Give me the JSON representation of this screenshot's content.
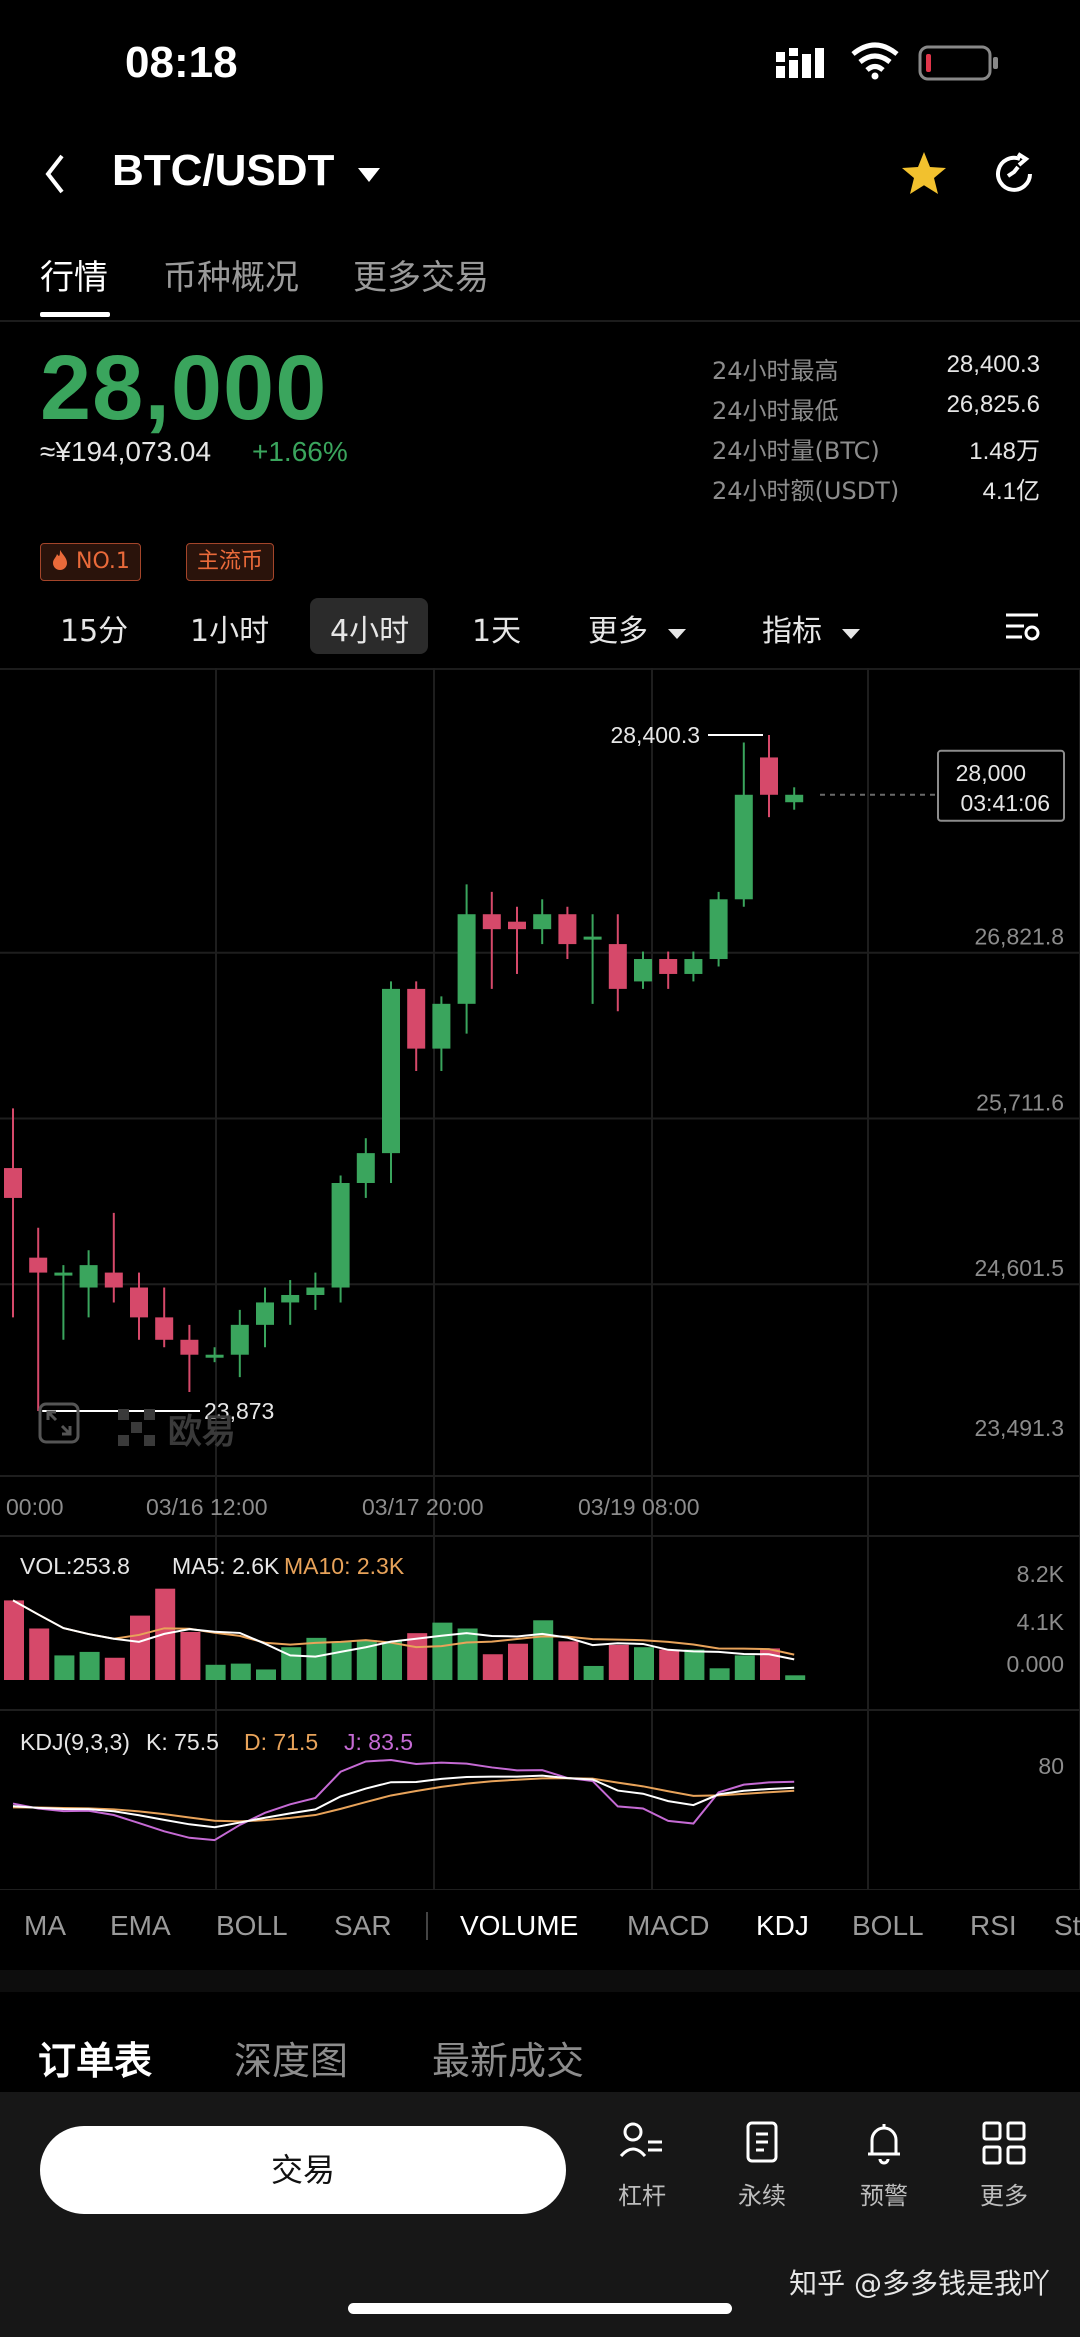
{
  "status_bar": {
    "time": "08:18"
  },
  "header": {
    "pair": "BTC/USDT"
  },
  "tabs": [
    "行情",
    "币种概况",
    "更多交易"
  ],
  "ticker": {
    "price": "28,000",
    "cny": "≈¥194,073.04",
    "change": "+1.66%",
    "stats": [
      {
        "label": "24小时最高",
        "value": "28,400.3"
      },
      {
        "label": "24小时最低",
        "value": "26,825.6"
      },
      {
        "label": "24小时量(BTC)",
        "value": "1.48万"
      },
      {
        "label": "24小时额(USDT)",
        "value": "4.1亿"
      }
    ]
  },
  "badges": [
    "NO.1",
    "主流币"
  ],
  "timeframes": {
    "items": [
      "15分",
      "1小时",
      "4小时",
      "1天"
    ],
    "more": "更多",
    "indicator": "指标",
    "selected": "4小时"
  },
  "chart": {
    "price_axis": [
      "26,821.8",
      "25,711.6",
      "24,601.5",
      "23,491.3"
    ],
    "high_label": "28,400.3",
    "low_label": "23,873",
    "last_price": "28,000",
    "countdown": "03:41:06",
    "watermark": "欧易",
    "time_axis": [
      "00:00",
      "03/16 12:00",
      "03/17 20:00",
      "03/19 08:00"
    ],
    "vol_legend": {
      "vol": "VOL:253.8",
      "ma5": "MA5: 2.6K",
      "ma10": "MA10: 2.3K"
    },
    "vol_axis": [
      "8.2K",
      "4.1K",
      "0.000"
    ],
    "kdj_legend": {
      "label": "KDJ(9,3,3)",
      "k": "K: 75.5",
      "d": "D: 71.5",
      "j": "J: 83.5"
    },
    "kdj_axis": [
      "80"
    ],
    "up_color": "#3aa55d",
    "down_color": "#d6496a"
  },
  "chart_data": {
    "type": "candlestick",
    "candles": [
      [
        25500,
        25300,
        25900,
        24500
      ],
      [
        24900,
        24800,
        25100,
        23873
      ],
      [
        24800,
        24800,
        24850,
        24350
      ],
      [
        24700,
        24850,
        24950,
        24500
      ],
      [
        24800,
        24700,
        25200,
        24600
      ],
      [
        24700,
        24500,
        24800,
        24350
      ],
      [
        24500,
        24350,
        24700,
        24300
      ],
      [
        24350,
        24250,
        24450,
        24000
      ],
      [
        24250,
        24250,
        24300,
        24200
      ],
      [
        24250,
        24450,
        24550,
        24100
      ],
      [
        24450,
        24600,
        24700,
        24300
      ],
      [
        24600,
        24650,
        24750,
        24450
      ],
      [
        24650,
        24700,
        24800,
        24550
      ],
      [
        24700,
        25400,
        25450,
        24600
      ],
      [
        25400,
        25600,
        25700,
        25300
      ],
      [
        25600,
        26700,
        26750,
        25400
      ],
      [
        26700,
        26300,
        26750,
        26150
      ],
      [
        26300,
        26600,
        26650,
        26150
      ],
      [
        26600,
        27200,
        27400,
        26400
      ],
      [
        27200,
        27100,
        27350,
        26700
      ],
      [
        27150,
        27100,
        27250,
        26800
      ],
      [
        27100,
        27200,
        27300,
        27000
      ],
      [
        27200,
        27000,
        27250,
        26900
      ],
      [
        27050,
        27050,
        27200,
        26600
      ],
      [
        27000,
        26700,
        27200,
        26550
      ],
      [
        26750,
        26900,
        26950,
        26700
      ],
      [
        26900,
        26800,
        26950,
        26700
      ],
      [
        26800,
        26900,
        26950,
        26750
      ],
      [
        26900,
        27300,
        27350,
        26850
      ],
      [
        27300,
        28000,
        28350,
        27250
      ],
      [
        28250,
        28000,
        28400.3,
        27850
      ],
      [
        27950,
        28000,
        28050,
        27900
      ]
    ],
    "volume_k": [
      6.8,
      4.4,
      2.1,
      2.4,
      1.9,
      5.5,
      7.8,
      4.1,
      1.3,
      1.4,
      0.9,
      2.8,
      3.6,
      3.3,
      3.4,
      3.3,
      4.0,
      4.9,
      4.4,
      2.2,
      3.1,
      5.1,
      3.3,
      1.2,
      3.0,
      2.8,
      2.6,
      2.6,
      1.0,
      2.1,
      2.7,
      0.4
    ],
    "ylim": [
      23491.3,
      28400.3
    ],
    "x_ticks": [
      "00:00",
      "03/16 12:00",
      "03/17 20:00",
      "03/19 08:00"
    ]
  },
  "indicator_tabs": [
    "MA",
    "EMA",
    "BOLL",
    "SAR",
    "VOLUME",
    "MACD",
    "KDJ",
    "BOLL",
    "RSI",
    "St"
  ],
  "order_tabs": [
    "订单表",
    "深度图",
    "最新成交"
  ],
  "bottom_nav": {
    "trade": "交易",
    "items": [
      "杠杆",
      "永续",
      "预警",
      "更多"
    ]
  },
  "watermark": "知乎 @多多钱是我吖"
}
